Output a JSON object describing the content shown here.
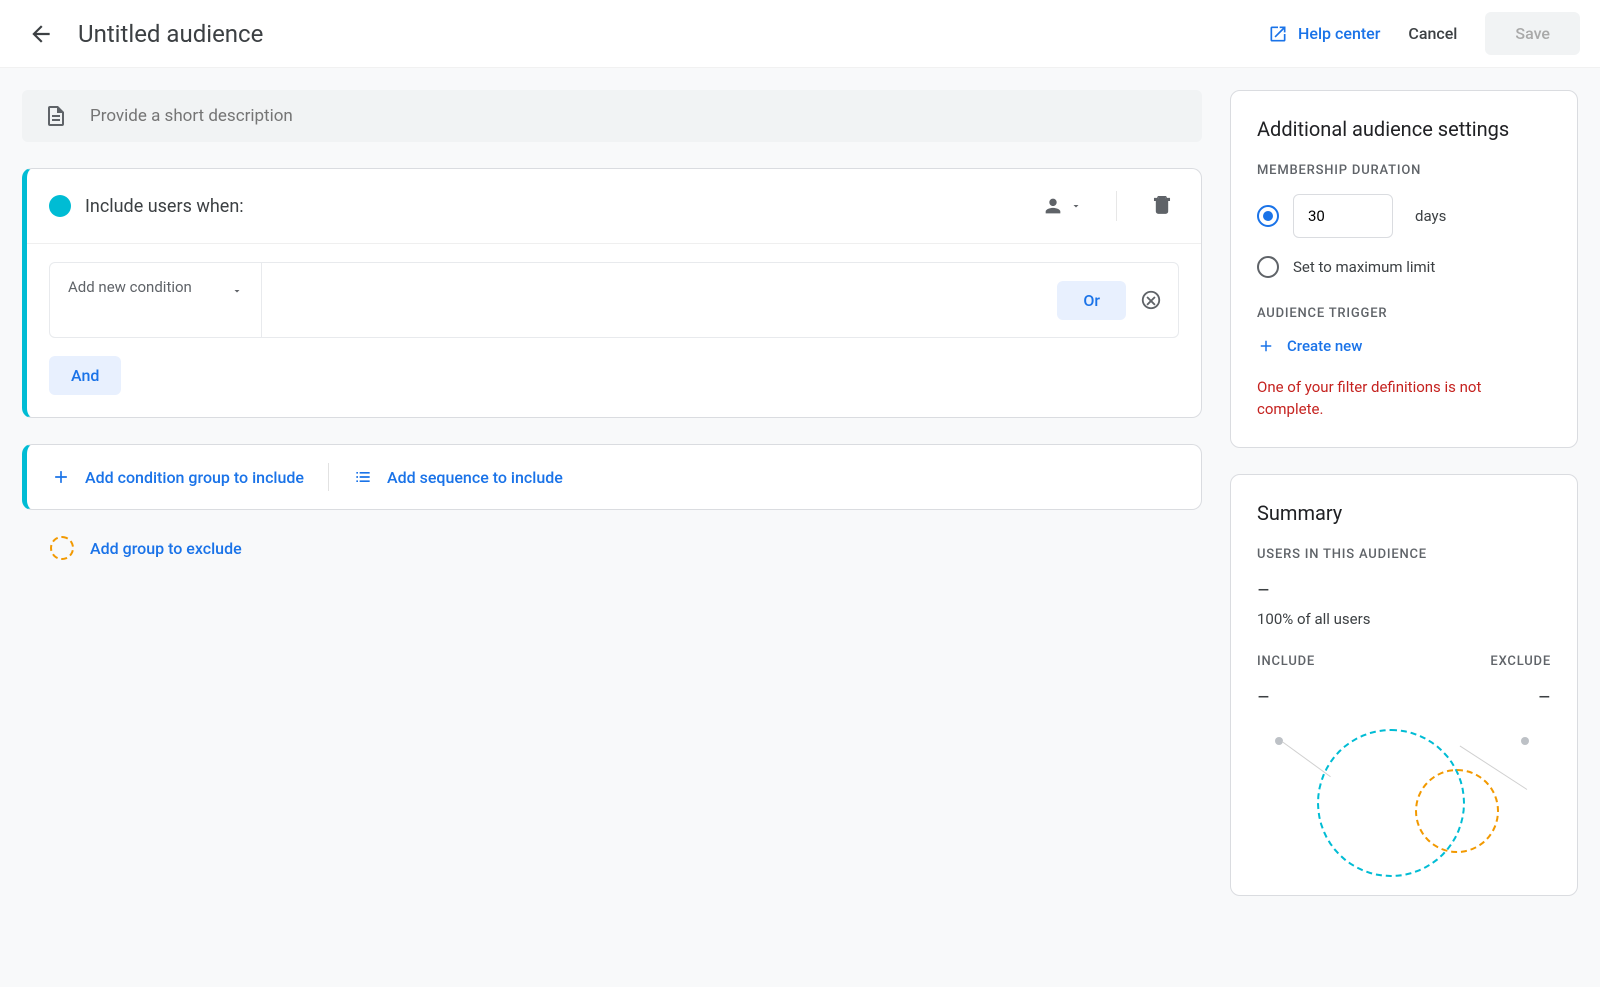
{
  "header": {
    "title": "Untitled audience",
    "help_label": "Help center",
    "cancel_label": "Cancel",
    "save_label": "Save"
  },
  "description": {
    "placeholder": "Provide a short description"
  },
  "include": {
    "title": "Include users when:",
    "add_condition_label": "Add new condition",
    "or_label": "Or",
    "and_label": "And"
  },
  "add_group": {
    "condition_group_label": "Add condition group to include",
    "sequence_label": "Add sequence to include"
  },
  "exclude": {
    "label": "Add group to exclude"
  },
  "settings": {
    "title": "Additional audience settings",
    "membership_label": "MEMBERSHIP DURATION",
    "duration_value": "30",
    "days_label": "days",
    "max_limit_label": "Set to maximum limit",
    "trigger_label": "AUDIENCE TRIGGER",
    "create_new_label": "Create new",
    "error_message": "One of your filter definitions is not complete."
  },
  "summary": {
    "title": "Summary",
    "users_label": "USERS IN THIS AUDIENCE",
    "users_value": "–",
    "users_pct": "100% of all users",
    "include_label": "INCLUDE",
    "exclude_label": "EXCLUDE",
    "include_value": "–",
    "exclude_value": "–"
  }
}
